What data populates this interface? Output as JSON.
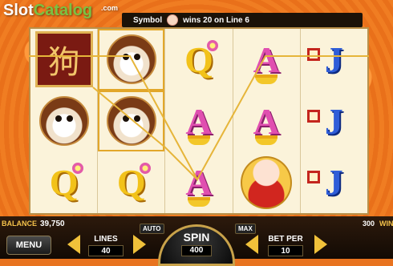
{
  "logo": {
    "slot": "Slot",
    "catalog": "Catalog",
    "com": ".com"
  },
  "info": {
    "prefix": "Symbol",
    "message": "wins 20 on Line 6"
  },
  "reels": [
    [
      "kanji",
      "dog",
      "q"
    ],
    [
      "dog",
      "dog",
      "q"
    ],
    [
      "q",
      "a",
      "a"
    ],
    [
      "a",
      "a",
      "baby"
    ],
    [
      "j",
      "j",
      "j"
    ]
  ],
  "symbols": {
    "q": "Q",
    "a": "A",
    "j": "J",
    "kanji": "狗"
  },
  "bottom": {
    "balance_label": "BALANCE",
    "balance_value": "39,750",
    "win_value": "300",
    "win_label": "WIN",
    "menu_label": "MENU",
    "lines_label": "LINES",
    "lines_value": "40",
    "auto_label": "AUTO",
    "max_label": "MAX",
    "spin_label": "SPIN",
    "spin_value": "400",
    "betper_label": "BET PER",
    "betper_value": "10"
  },
  "colors": {
    "accent": "#f0c13a",
    "background": "#e8731f",
    "win_line": "#e6b53a"
  }
}
